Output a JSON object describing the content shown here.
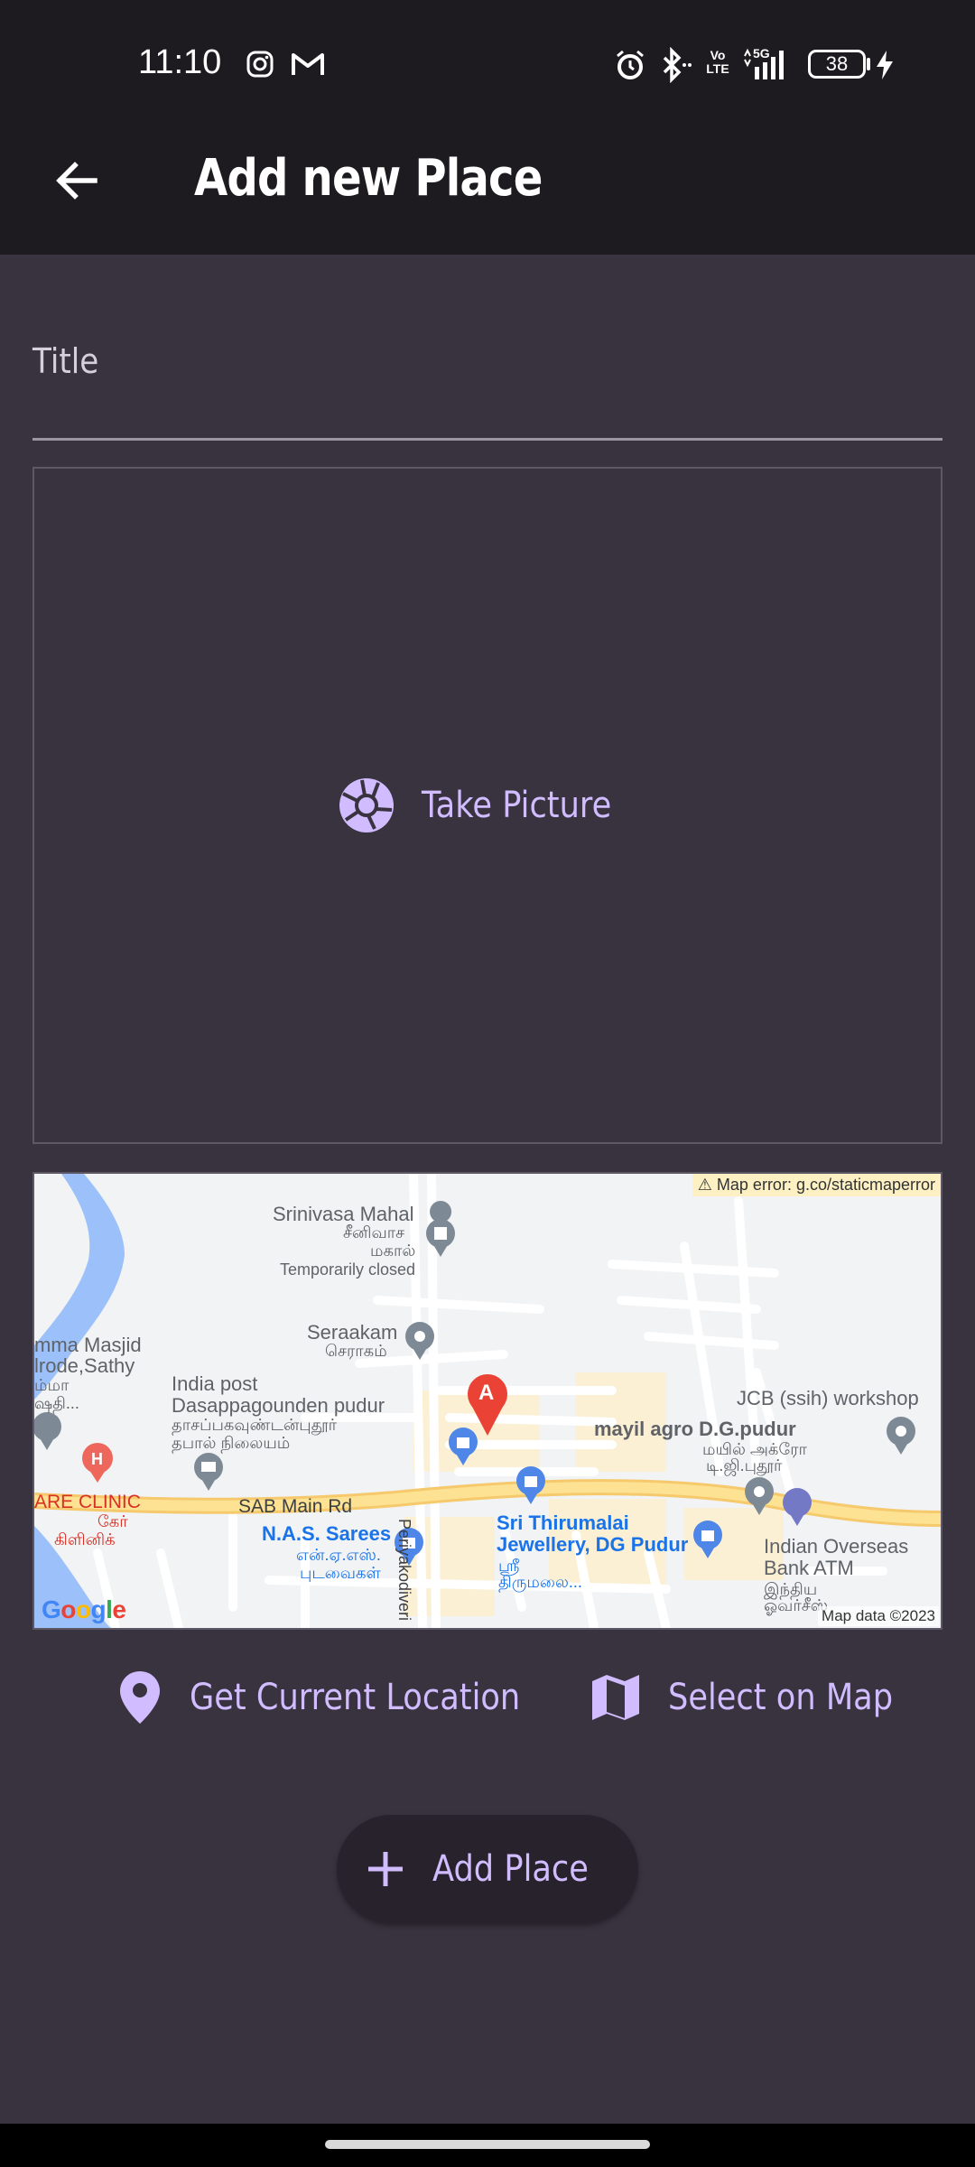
{
  "status_bar": {
    "time": "11:10",
    "battery": "38",
    "network": "5G",
    "volte": "Vo LTE",
    "icons": [
      "instagram-icon",
      "gmail-icon",
      "alarm-icon",
      "bluetooth-icon",
      "volte-icon",
      "signal-icon",
      "battery-icon",
      "charging-icon"
    ]
  },
  "app_bar": {
    "title": "Add new Place",
    "back_icon": "arrow-back-icon"
  },
  "form": {
    "title_label": "Title",
    "title_value": "",
    "take_picture_label": "Take Picture",
    "take_picture_icon": "camera-shutter-icon"
  },
  "map": {
    "error_text": "⚠ Map error: g.co/staticmaperror",
    "data_text": "Map data ©2023",
    "logo_text": "Google",
    "labels": {
      "srinivasa": "Srinivasa Mahal",
      "srinivasa_ta": "சீனிவாச",
      "srinivasa_ta2": "மகால்",
      "temp_closed": "Temporarily closed",
      "seraakam": "Seraakam",
      "seraakam_ta": "செராகம்",
      "masjid": "mma Masjid",
      "masjid2": "lrode,Sathy",
      "masjid_ta": "ம்மா",
      "masjid_ta2": "ஷதி...",
      "india_post": "India post",
      "india_post2": "Dasappagounden pudur",
      "india_post_ta": "தாசப்பகவுண்டன்புதூர்",
      "india_post_ta2": "தபால் நிலையம்",
      "clinic": "ARE CLINIC",
      "clinic_ta": "கேர்",
      "clinic_ta2": "கிளினிக்",
      "sab_road": "SAB Main Rd",
      "nas": "N.A.S. Sarees",
      "nas_ta": "என்.ஏ.எஸ்.",
      "nas_ta2": "புடவைகள்",
      "periya": "Periyakodiveri",
      "jcb": "JCB (ssih) workshop",
      "mayil": "mayil agro D.G.pudur",
      "mayil_ta": "மயில் அக்ரோ",
      "mayil_ta2": "டி.ஜி.புதூர்",
      "thirumalai": "Sri Thirumalai",
      "thirumalai2": "Jewellery, DG Pudur",
      "thirumalai_ta": "ஸ்ரீ",
      "thirumalai_ta2": "திருமலை...",
      "iob": "Indian Overseas",
      "iob2": "Bank ATM",
      "iob_ta": "இந்திய",
      "iob_ta2": "ஓவர்சீஸ்",
      "marker": "A"
    }
  },
  "actions": {
    "current_location_label": "Get Current Location",
    "current_location_icon": "location-pin-icon",
    "select_map_label": "Select on Map",
    "select_map_icon": "map-icon",
    "add_place_label": "Add Place",
    "add_place_icon": "plus-icon"
  },
  "colors": {
    "background": "#39333f",
    "bar": "#1d1b1f",
    "accent": "#d0bcff",
    "button_bg": "#27222c"
  }
}
